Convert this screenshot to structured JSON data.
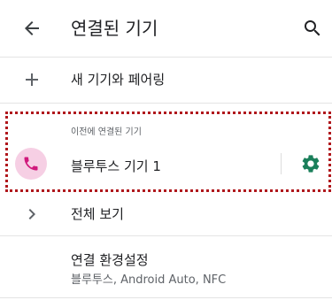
{
  "appbar": {
    "title": "연결된 기기",
    "back_icon": "arrow-back-icon",
    "search_icon": "search-icon"
  },
  "pair_new": {
    "label": "새 기기와 페어링",
    "icon": "plus-icon"
  },
  "previously_connected": {
    "header": "이전에 연결된 기기",
    "device": {
      "label": "블루투스 기기 1",
      "icon": "phone-icon",
      "settings_icon": "gear-icon"
    }
  },
  "see_all": {
    "label": "전체 보기",
    "icon": "chevron-right-icon"
  },
  "connection_prefs": {
    "label": "연결 환경설정",
    "sub": "블루투스, Android Auto, NFC"
  },
  "colors": {
    "accent_green": "#1a7f5a",
    "phone_icon": "#d0197c",
    "phone_bg": "#f6cfe4",
    "highlight_border": "#b0171c"
  }
}
